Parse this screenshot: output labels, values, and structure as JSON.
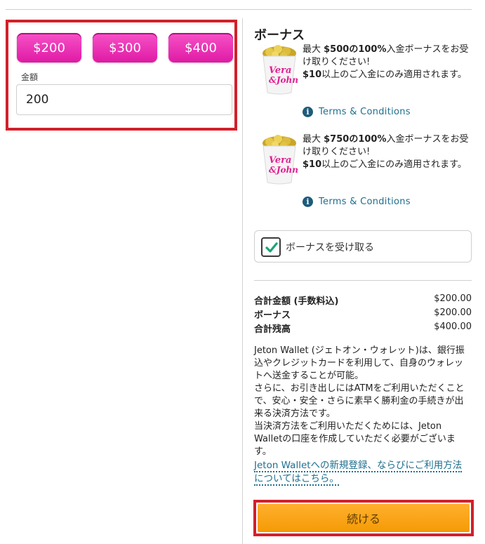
{
  "deposit": {
    "quick_amounts": [
      "$200",
      "$300",
      "$400"
    ],
    "amount_label": "金額",
    "amount_value": "200"
  },
  "bonus": {
    "title": "ボーナス",
    "offers": [
      {
        "line1_a": "最大 ",
        "line1_b": "$500の100%",
        "line1_c": "入金ボーナスをお受け取りください!",
        "line2_a": "$10",
        "line2_b": "以上のご入金にのみ適用されます。",
        "terms_label": "Terms & Conditions",
        "brand": "Vera & John"
      },
      {
        "line1_a": "最大 ",
        "line1_b": "$750の100%",
        "line1_c": "入金ボーナスをお受け取りください!",
        "line2_a": "$10",
        "line2_b": "以上のご入金にのみ適用されます。",
        "terms_label": "Terms & Conditions",
        "brand": "Vera & John"
      }
    ],
    "accept_label": "ボーナスを受け取る",
    "accept_checked": true
  },
  "summary": {
    "rows": [
      {
        "label": "合計金額 (手数料込)",
        "value": "$200.00"
      },
      {
        "label": "ボーナス",
        "value": "$200.00"
      },
      {
        "label": "合計残高",
        "value": "$400.00"
      }
    ]
  },
  "description": {
    "p1": "Jeton Wallet (ジェトオン・ウォレット)は、銀行振込やクレジットカードを利用して、自身のウォレットへ送金することが可能。",
    "p2": "さらに、お引き出しにはATMをご利用いただくことで、安心・安全・さらに素早く勝利金の手続きが出来る決済方法です。",
    "p3": "当決済方法をご利用いただくためには、Jeton Walletの口座を作成していただく必要がございます。",
    "link": "Jeton Walletへの新規登録、ならびにご利用方法についてはこちら。"
  },
  "continue_label": "続ける",
  "colors": {
    "pink": "#e91eaa",
    "highlight_red": "#d2202a",
    "continue_orange": "#f8a51a",
    "link_blue": "#1f6f8f",
    "check_green": "#1aa37a"
  }
}
